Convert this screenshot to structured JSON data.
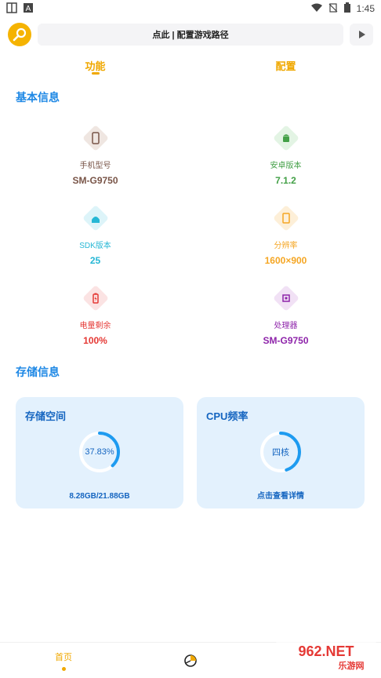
{
  "status_bar": {
    "time": "1:45",
    "left_icons": [
      "app-icon",
      "a-icon"
    ],
    "right_icons": [
      "wifi-icon",
      "no-sim-icon",
      "battery-icon"
    ]
  },
  "topbar": {
    "path_label": "点此 | 配置游戏路径",
    "logo_icon": "wrench-icon",
    "play_icon": "play-icon"
  },
  "tabs": [
    {
      "label": "功能",
      "active": true
    },
    {
      "label": "配置",
      "active": false
    }
  ],
  "basic_info": {
    "title": "基本信息",
    "items": [
      {
        "label": "手机型号",
        "value": "SM-G9750",
        "color": "#795548",
        "bg": "#EFE6E1",
        "icon": "phone-icon"
      },
      {
        "label": "安卓版本",
        "value": "7.1.2",
        "color": "#43A047",
        "bg": "#E3F4E4",
        "icon": "android-icon"
      },
      {
        "label": "SDK版本",
        "value": "25",
        "color": "#26B7D5",
        "bg": "#DDF4F9",
        "icon": "android-head-icon"
      },
      {
        "label": "分辨率",
        "value": "1600×900",
        "color": "#F5A623",
        "bg": "#FDEFD8",
        "icon": "screen-icon"
      },
      {
        "label": "电量剩余",
        "value": "100%",
        "color": "#E53935",
        "bg": "#FBE3E3",
        "icon": "battery-icon"
      },
      {
        "label": "处理器",
        "value": "SM-G9750",
        "color": "#8E24AA",
        "bg": "#F1E1F5",
        "icon": "chip-icon"
      }
    ]
  },
  "storage": {
    "title": "存储信息",
    "cards": [
      {
        "title": "存储空间",
        "center": "37.83%",
        "footer": "8.28GB/21.88GB",
        "progress": 0.3783
      },
      {
        "title": "CPU频率",
        "center": "四核",
        "footer": "点击查看详情",
        "progress": 0.45
      }
    ]
  },
  "bottom_nav": {
    "home_label": "首页",
    "center_icon": "pie-chart-icon"
  },
  "watermark": {
    "text": "962.NET",
    "sub": "乐游网"
  },
  "colors": {
    "accent": "#F0A800",
    "blue": "#1E88E5",
    "card_bg": "#E3F1FD",
    "ring": "#1E9BF0"
  }
}
